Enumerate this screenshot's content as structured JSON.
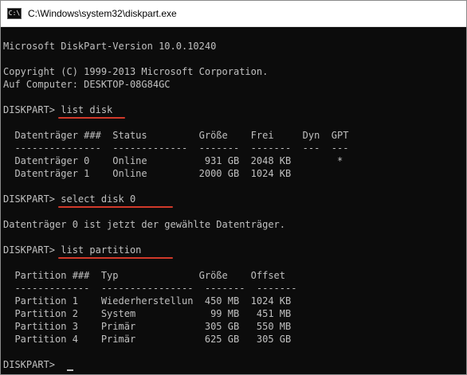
{
  "window": {
    "title": "C:\\Windows\\system32\\diskpart.exe"
  },
  "console": {
    "version_line": "Microsoft DiskPart-Version 10.0.10240",
    "copyright_line": "Copyright (C) 1999-2013 Microsoft Corporation.",
    "computer_line": "Auf Computer: DESKTOP-08G84GC",
    "cmd1": "DISKPART> list disk",
    "disk_header": "  Datenträger ###  Status         Größe    Frei     Dyn  GPT",
    "disk_separator": "  ---------------  -------------  -------  -------  ---  ---",
    "disk_rows": [
      "  Datenträger 0    Online          931 GB  2048 KB        *",
      "  Datenträger 1    Online         2000 GB  1024 KB"
    ],
    "cmd2": "DISKPART> select disk 0",
    "select_result": "Datenträger 0 ist jetzt der gewählte Datenträger.",
    "cmd3": "DISKPART> list partition",
    "part_header": "  Partition ###  Typ              Größe    Offset",
    "part_separator": "  -------------  ----------------  -------  -------",
    "part_rows": [
      "  Partition 1    Wiederherstellun  450 MB  1024 KB",
      "  Partition 2    System             99 MB   451 MB",
      "  Partition 3    Primär            305 GB   550 MB",
      "  Partition 4    Primär            625 GB   305 GB"
    ],
    "prompt": "DISKPART> "
  }
}
